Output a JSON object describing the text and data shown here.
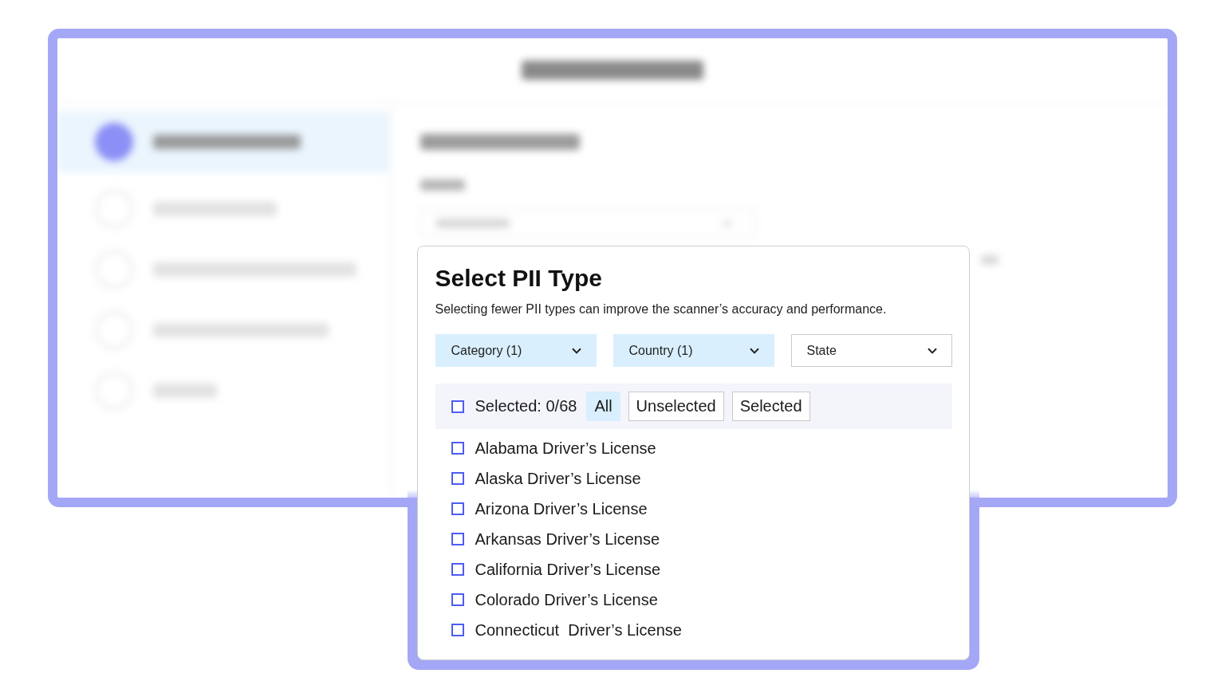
{
  "modal": {
    "title": "Select PII Type",
    "description": "Selecting fewer PII types can improve the scanner’s accuracy and performance.",
    "filters": [
      {
        "label": "Category (1)",
        "active": true
      },
      {
        "label": "Country (1)",
        "active": true
      },
      {
        "label": "State",
        "active": false
      }
    ],
    "select_all": {
      "checked": false,
      "label": "Selected: 0/68"
    },
    "view_tabs": [
      {
        "label": "All",
        "selected": true
      },
      {
        "label": "Unselected",
        "selected": false
      },
      {
        "label": "Selected",
        "selected": false
      }
    ],
    "pii_types": [
      {
        "label": "Alabama Driver’s License",
        "checked": false
      },
      {
        "label": "Alaska Driver’s License",
        "checked": false
      },
      {
        "label": "Arizona Driver’s License",
        "checked": false
      },
      {
        "label": "Arkansas Driver’s License",
        "checked": false
      },
      {
        "label": "California Driver’s License",
        "checked": false
      },
      {
        "label": "Colorado Driver’s License",
        "checked": false
      },
      {
        "label": "Connecticut  Driver’s License",
        "checked": false
      }
    ]
  }
}
